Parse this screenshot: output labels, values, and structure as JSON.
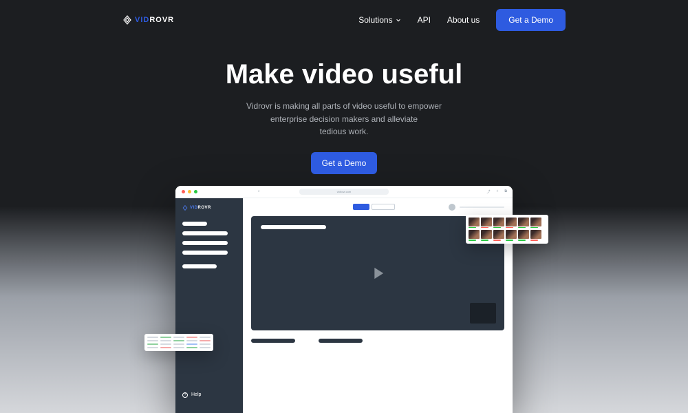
{
  "nav": {
    "logo_vid": "VID",
    "logo_rovr": "ROVR",
    "solutions": "Solutions",
    "api": "API",
    "about": "About us",
    "cta": "Get a Demo"
  },
  "hero": {
    "title": "Make video useful",
    "subtitle_l1": "Vidrovr is making all parts of video useful to empower",
    "subtitle_l2": "enterprise decision makers and alleviate",
    "subtitle_l3": "tedious work.",
    "cta": "Get a Demo"
  },
  "mockup": {
    "url": "vidrovr.com",
    "sidebar_logo_vid": "VID",
    "sidebar_logo_rovr": "ROVR",
    "help": "Help"
  }
}
